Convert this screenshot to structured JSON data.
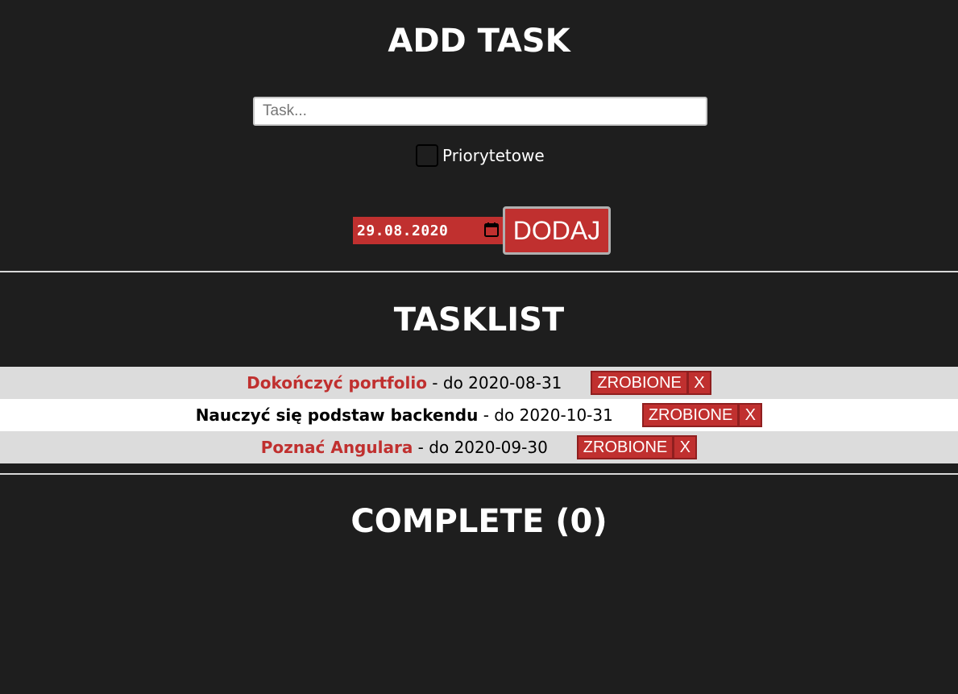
{
  "add_section": {
    "title": "ADD TASK",
    "task_input": {
      "placeholder": "Task...",
      "value": ""
    },
    "priority_label": "Priorytetowe",
    "date_value": "29.08.2020",
    "add_button_label": "DODAJ"
  },
  "tasklist_section": {
    "title": "TASKLIST",
    "tasks": [
      {
        "name": "Dokończyć portfolio",
        "separator": " - do ",
        "date": "2020-08-31",
        "priority": true,
        "done_label": "ZROBIONE",
        "remove_label": "X"
      },
      {
        "name": "Nauczyć się podstaw backendu",
        "separator": " - do ",
        "date": "2020-10-31",
        "priority": false,
        "done_label": "ZROBIONE",
        "remove_label": "X"
      },
      {
        "name": "Poznać Angulara",
        "separator": " - do ",
        "date": "2020-09-30",
        "priority": true,
        "done_label": "ZROBIONE",
        "remove_label": "X"
      }
    ]
  },
  "complete_section": {
    "title": "COMPLETE (0)"
  },
  "colors": {
    "background": "#1e1e1e",
    "accent": "#c0302f",
    "row_odd": "#dcdcdc",
    "row_even": "#ffffff"
  },
  "icons": {
    "calendar": "calendar-icon"
  }
}
